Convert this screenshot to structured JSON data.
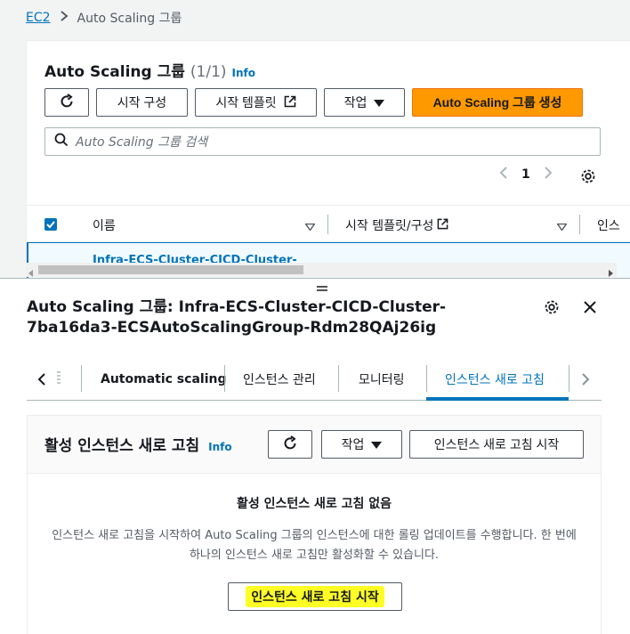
{
  "breadcrumb": {
    "root": "EC2",
    "current": "Auto Scaling 그룹"
  },
  "asg_list": {
    "title": "Auto Scaling 그룹",
    "count": "(1/1)",
    "info": "Info",
    "buttons": {
      "launch_config": "시작 구성",
      "launch_template": "시작 템플릿",
      "actions": "작업",
      "create": "Auto Scaling 그룹 생성"
    },
    "search_placeholder": "Auto Scaling 그룹 검색",
    "page_number": "1",
    "columns": [
      "이름",
      "시작 템플릿/구성",
      "인스"
    ],
    "rows": [
      {
        "name": "Infra-ECS-Cluster-CICD-Cluster-"
      }
    ]
  },
  "split_panel": {
    "title": "Auto Scaling 그룹: Infra-ECS-Cluster-CICD-Cluster-7ba16da3-ECSAutoScalingGroup-Rdm28QAj26ig",
    "tabs": [
      "Automatic scaling",
      "인스턴스 관리",
      "모니터링",
      "인스턴스 새로 고침"
    ],
    "active_tab": "인스턴스 새로 고침",
    "refresh_section": {
      "title": "활성 인스턴스 새로 고침",
      "info": "Info",
      "actions": "작업",
      "start_button": "인스턴스 새로 고침 시작",
      "empty_title": "활성 인스턴스 새로 고침 없음",
      "empty_desc": "인스턴스 새로 고침을 시작하여 Auto Scaling 그룹의 인스턴스에 대한 롤링 업데이트를 수행합니다. 한 번에 하나의 인스턴스 새로 고침만 활성화할 수 있습니다.",
      "empty_button": "인스턴스 새로 고침 시작"
    }
  },
  "colors": {
    "accent": "#0073bb",
    "primary": "#ff9900",
    "highlight": "#ffff26"
  }
}
